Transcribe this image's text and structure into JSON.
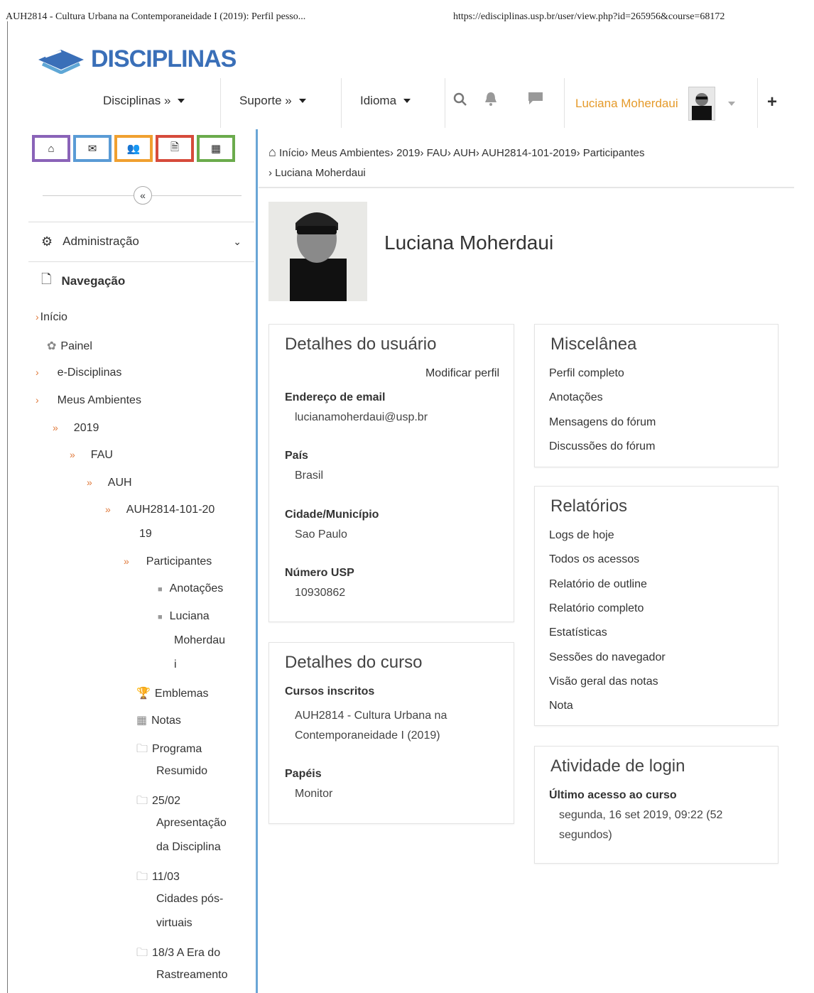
{
  "print_header": {
    "title": "AUH2814 - Cultura Urbana na Contemporaneidade I (2019): Perfil pesso...",
    "url": "https://edisciplinas.usp.br/user/view.php?id=265956&course=68172"
  },
  "logo": {
    "text": "DISCIPLINAS",
    "brand_color": "#3a6fb8"
  },
  "navbar": {
    "disciplinas": "Disciplinas »",
    "suporte": "Suporte »",
    "idioma": "Idioma",
    "user_name": "Luciana Moherdaui",
    "plus": "+"
  },
  "quick_buttons": [
    {
      "name": "home-button",
      "icon": "home-icon",
      "glyph": "⌂",
      "color": "#8a63b8"
    },
    {
      "name": "messages-button",
      "icon": "mail-icon",
      "glyph": "✉",
      "color": "#5a9bd5"
    },
    {
      "name": "participants-button",
      "icon": "users-icon",
      "glyph": "👥",
      "color": "#f0a030"
    },
    {
      "name": "notes-button",
      "icon": "file-icon",
      "glyph": "🗎",
      "color": "#d64b3b"
    },
    {
      "name": "grades-button",
      "icon": "grid-icon",
      "glyph": "▦",
      "color": "#6bab4c"
    }
  ],
  "drawer": {
    "collapse_glyph": "«",
    "administracao": "Administração",
    "navegacao": "Navegação",
    "tree": {
      "inicio": "Início",
      "painel": "Painel",
      "edisciplinas": "e-Disciplinas",
      "meus_ambientes": "Meus Ambientes",
      "y2019": "2019",
      "fau": "FAU",
      "auh": "AUH",
      "course1": "AUH2814-101-20",
      "course2": "19",
      "participantes": "Participantes",
      "anotacoes": "Anotações",
      "luciana1": "Luciana",
      "luciana2": "Moherdau",
      "luciana3": "i",
      "emblemas": "Emblemas",
      "notas": "Notas",
      "programa1": "Programa",
      "programa2": "Resumido",
      "d2502a": "25/02",
      "d2502b": "Apresentação",
      "d2502c": "da Disciplina",
      "d1103a": "11/03",
      "d1103b": "Cidades pós-",
      "d1103c": "virtuais",
      "d1803a": "18/3 A Era do",
      "d1803b": "Rastreamento"
    }
  },
  "breadcrumb": {
    "line1": "Início› Meus Ambientes› 2019› FAU› AUH› AUH2814-101-2019› Participantes",
    "line2": "› Luciana Moherdaui"
  },
  "profile": {
    "fullname": "Luciana Moherdaui"
  },
  "user_details": {
    "title": "Detalhes do usuário",
    "edit": "Modificar perfil",
    "email_label": "Endereço de email",
    "email": "lucianamoherdaui@usp.br",
    "country_label": "País",
    "country": "Brasil",
    "city_label": "Cidade/Município",
    "city": "Sao Paulo",
    "usp_label": "Número USP",
    "usp": "10930862"
  },
  "course_details": {
    "title": "Detalhes do curso",
    "enrolled_label": "Cursos inscritos",
    "course_line1": "AUH2814 - Cultura Urbana na",
    "course_line2": "Contemporaneidade I (2019)",
    "roles_label": "Papéis",
    "role": "Monitor"
  },
  "misc": {
    "title": "Miscelânea",
    "links": [
      "Perfil completo",
      "Anotações",
      "Mensagens do fórum",
      "Discussões do fórum"
    ]
  },
  "reports": {
    "title": "Relatórios",
    "links": [
      "Logs de hoje",
      "Todos os acessos",
      "Relatório de outline",
      "Relatório completo",
      "Estatísticas",
      "Sessões do navegador",
      "Visão geral das notas",
      "Nota"
    ]
  },
  "login": {
    "title": "Atividade de login",
    "last_label": "Último acesso ao curso",
    "last_line1": "segunda, 16 set 2019, 09:22  (52",
    "last_line2": "segundos)"
  }
}
